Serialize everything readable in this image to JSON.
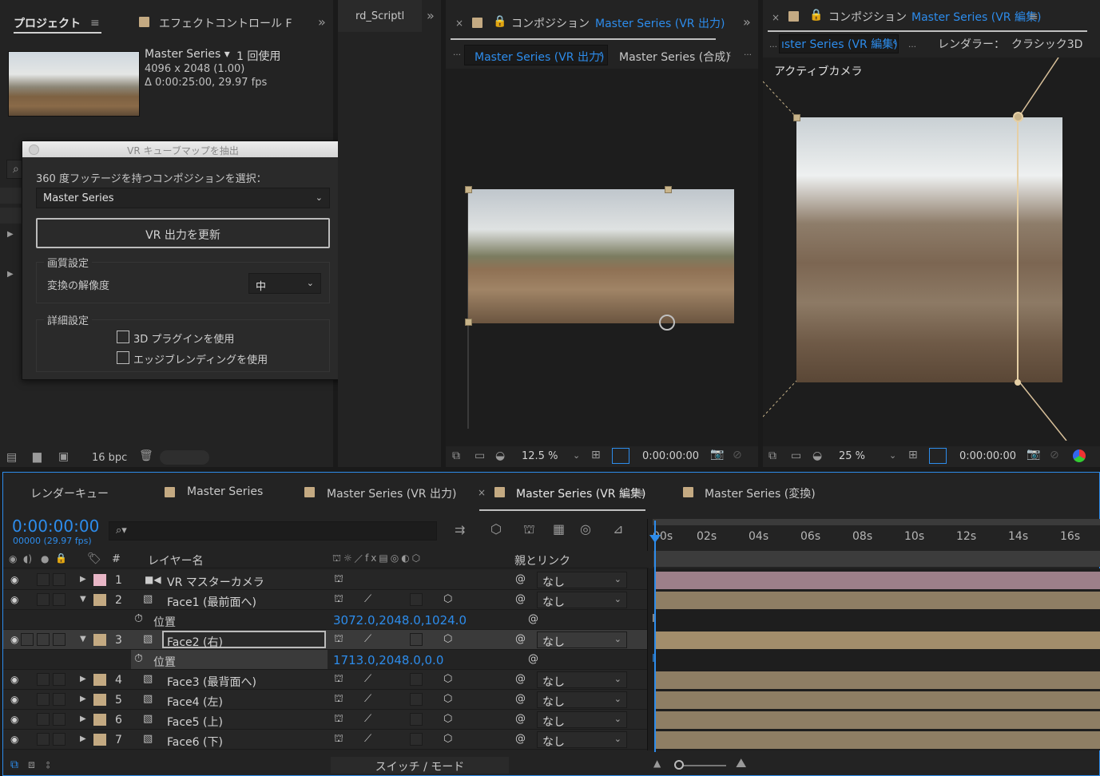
{
  "project": {
    "tab_title": "プロジェクト",
    "effects_tab": "エフェクトコントロール F",
    "footage_name": "Master Series ▾",
    "usage": "1 回使用",
    "dims": "4096 x 2048 (1.00)",
    "duration": "Δ 0:00:25:00, 29.97 fps",
    "bpc": "16 bpc"
  },
  "script_panel": {
    "tab": "rd_Scriptl"
  },
  "dialog": {
    "title": "VR キューブマップを抽出",
    "select_label": "360 度フッテージを持つコンポジションを選択：",
    "select_value": "Master Series",
    "update_button": "VR 出力を更新",
    "quality_group": "画質設定",
    "resolution_label": "変換の解像度",
    "resolution_value": "中",
    "advanced_group": "詳細設定",
    "checkbox1": "3D プラグインを使用",
    "checkbox2": "エッジブレンディングを使用"
  },
  "comp1": {
    "tab_label": "コンポジション",
    "tab_comp": "Master Series (VR 出力)",
    "sub_active": "Master Series (VR 出力)",
    "sub_other": "Master Series (合成)",
    "zoom": "12.5 %",
    "timecode": "0:00:00:00"
  },
  "comp2": {
    "tab_label": "コンポジション",
    "tab_comp": "Master Series (VR 編集)",
    "sub_active": "ıster Series (VR 編集)",
    "renderer_label": "レンダラー：",
    "renderer_value": "クラシック3D",
    "camera_label": "アクティブカメラ",
    "zoom": "25 %",
    "timecode": "0:00:00:00"
  },
  "timeline": {
    "tabs": [
      "レンダーキュー",
      "Master Series",
      "Master Series (VR 出力)",
      "Master Series (VR 編集)",
      "Master Series (変換)"
    ],
    "timecode": "0:00:00:00",
    "frames": "00000 (29.97 fps)",
    "col_layer": "レイヤー名",
    "col_parent": "親とリンク",
    "col_hash": "#",
    "ticks": [
      "00s",
      "02s",
      "04s",
      "06s",
      "08s",
      "10s",
      "12s",
      "14s",
      "16s"
    ],
    "layers": [
      {
        "num": "1",
        "name": "VR マスターカメラ",
        "parent": "なし",
        "color": "#e8b6c6",
        "bar": "#9d7f89"
      },
      {
        "num": "2",
        "name": "Face1 (最前面へ)",
        "parent": "なし",
        "color": "#c4aa82",
        "bar": "#8e7e64"
      },
      {
        "num": "3",
        "name": "Face2 (右)",
        "parent": "なし",
        "color": "#c4aa82",
        "bar": "#a28d6b"
      },
      {
        "num": "4",
        "name": "Face3 (最背面へ)",
        "parent": "なし",
        "color": "#c4aa82",
        "bar": "#8e7e64"
      },
      {
        "num": "5",
        "name": "Face4 (左)",
        "parent": "なし",
        "color": "#c4aa82",
        "bar": "#8e7e64"
      },
      {
        "num": "6",
        "name": "Face5 (上)",
        "parent": "なし",
        "color": "#c4aa82",
        "bar": "#8e7e64"
      },
      {
        "num": "7",
        "name": "Face6 (下)",
        "parent": "なし",
        "color": "#c4aa82",
        "bar": "#8e7e64"
      }
    ],
    "position_label": "位置",
    "pos2": "3072.0,2048.0,1024.0",
    "pos3": "1713.0,2048.0,0.0",
    "switch_mode": "スイッチ / モード"
  }
}
